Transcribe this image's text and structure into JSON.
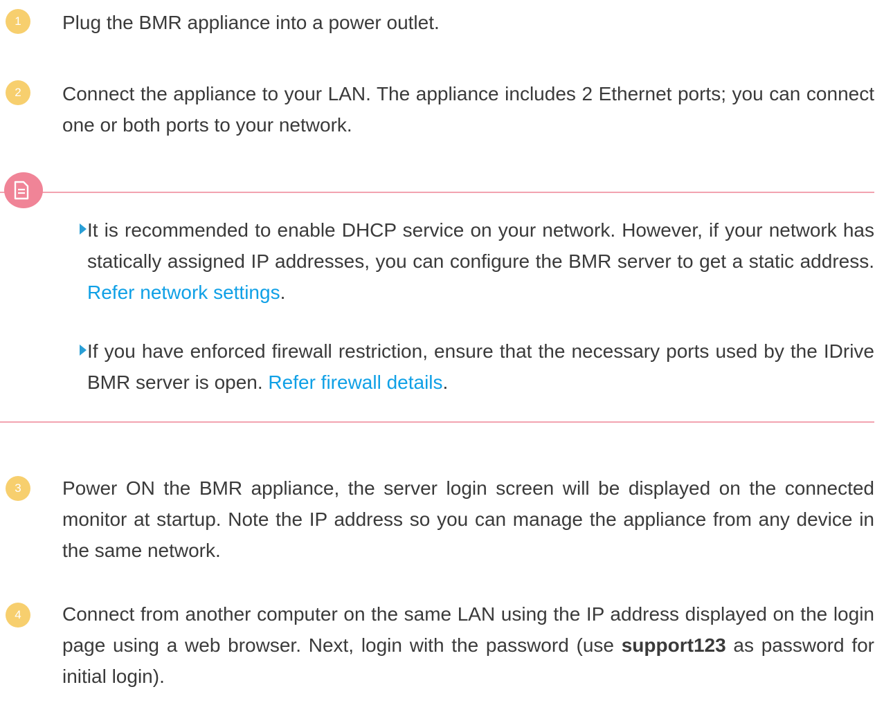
{
  "steps": [
    {
      "num": "1",
      "text": "Plug the BMR appliance into a power outlet."
    },
    {
      "num": "2",
      "text": "Connect the appliance to your LAN. The appliance includes 2 Ethernet ports; you can connect one or both ports to your network."
    },
    {
      "num": "3",
      "text": "Power ON the BMR appliance, the server login screen will be displayed on the connected monitor at startup. Note the IP address so you can manage the appliance from any device in the same network."
    },
    {
      "num": "4",
      "text_before": "Connect from another computer on the same LAN using the IP address displayed on the login page using a web browser. Next, login with the password (use ",
      "bold": "support123",
      "text_after": " as password for initial login)."
    }
  ],
  "note": {
    "icon": "document-icon",
    "colors": {
      "accent": "#f08497",
      "line": "#f2a3b0",
      "bullet": "#2a9fd6",
      "link": "#0fa0e6",
      "step_badge": "#f7cf6e"
    },
    "bullets": [
      {
        "text": "It is recommended to enable DHCP service on your network. However, if your network has statically assigned IP addresses, you can configure the BMR server to get a static address. ",
        "link": "Refer network settings",
        "after": "."
      },
      {
        "text": "If you have enforced firewall restriction, ensure that the necessary ports used by the IDrive BMR server is open. ",
        "link": "Refer firewall details",
        "after": "."
      }
    ]
  }
}
